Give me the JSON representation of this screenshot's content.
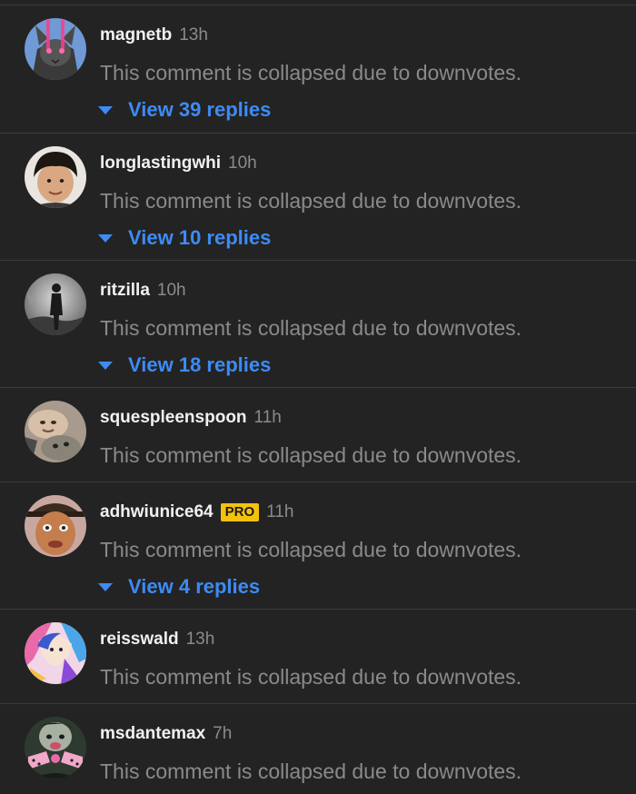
{
  "comments": [
    {
      "username": "magnetb",
      "time": "13h",
      "badge": "",
      "text": "This comment is collapsed due to downvotes.",
      "replies_label": "View 39 replies",
      "avatar_icon": "cat-avatar-icon"
    },
    {
      "username": "longlastingwhi",
      "time": "10h",
      "badge": "",
      "text": "This comment is collapsed due to downvotes.",
      "replies_label": "View 10 replies",
      "avatar_icon": "boy-avatar-icon"
    },
    {
      "username": "ritzilla",
      "time": "10h",
      "badge": "",
      "text": "This comment is collapsed due to downvotes.",
      "replies_label": "View 18 replies",
      "avatar_icon": "silhouette-avatar-icon"
    },
    {
      "username": "squespleenspoon",
      "time": "11h",
      "badge": "",
      "text": "This comment is collapsed due to downvotes.",
      "replies_label": "",
      "avatar_icon": "dog-avatar-icon"
    },
    {
      "username": "adhwiunice64",
      "time": "11h",
      "badge": "PRO",
      "text": "This comment is collapsed due to downvotes.",
      "replies_label": "View 4 replies",
      "avatar_icon": "face-avatar-icon"
    },
    {
      "username": "reisswald",
      "time": "13h",
      "badge": "",
      "text": "This comment is collapsed due to downvotes.",
      "replies_label": "",
      "avatar_icon": "anime-avatar-icon"
    },
    {
      "username": "msdantemax",
      "time": "7h",
      "badge": "",
      "text": "This comment is collapsed due to downvotes.",
      "replies_label": "",
      "avatar_icon": "clown-avatar-icon"
    }
  ],
  "colors": {
    "background": "#232323",
    "divider": "#3b3b3b",
    "username": "#f1f1f1",
    "muted": "#8a8a8a",
    "link": "#3d8bf5",
    "pro_badge": "#f4c20d"
  }
}
